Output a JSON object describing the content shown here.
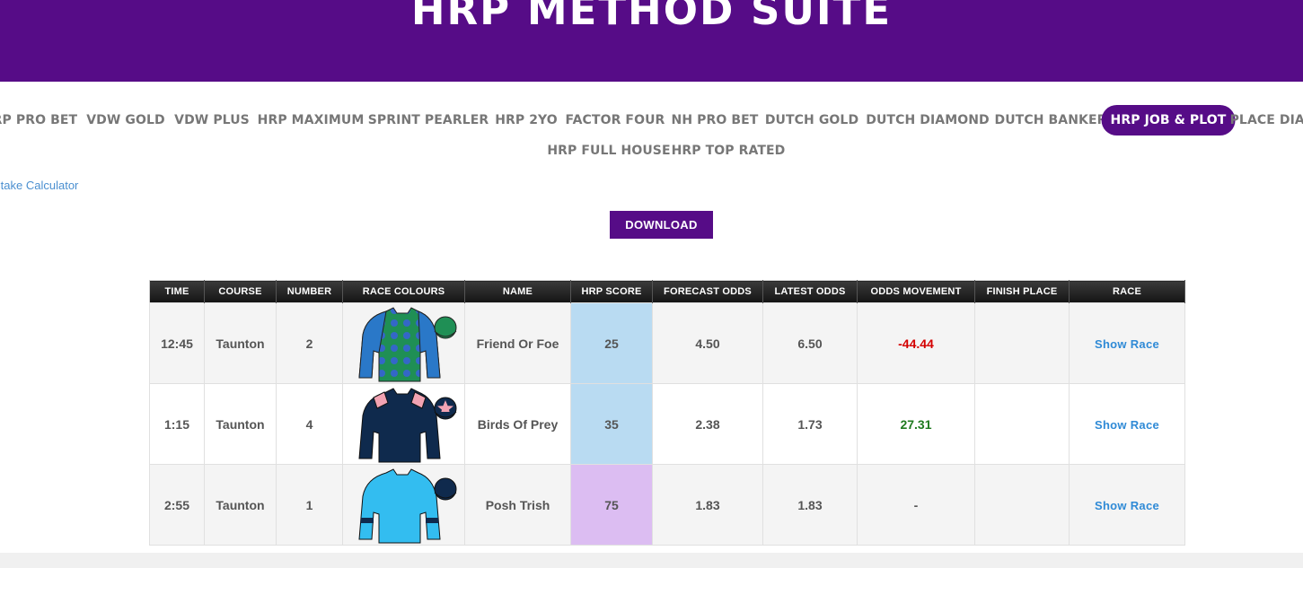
{
  "header": {
    "title": "HRP METHOD SUITE"
  },
  "nav": {
    "row1": [
      "HRP PRO BET",
      "VDW GOLD",
      "VDW PLUS",
      "HRP MAXIMUM",
      "SPRINT PEARLER",
      "HRP 2YO",
      "FACTOR FOUR",
      "NH PRO BET",
      "DUTCH GOLD",
      "DUTCH DIAMOND",
      "DUTCH BANKER",
      "HRP JOB & PLOT",
      "PLACE DIAMOND"
    ],
    "row2": [
      "HRP FULL HOUSE",
      "HRP TOP RATED"
    ],
    "active": "HRP JOB & PLOT"
  },
  "calculator_link": "Stake Calculator",
  "download_label": "DOWNLOAD",
  "table": {
    "columns": [
      "TIME",
      "COURSE",
      "NUMBER",
      "RACE COLOURS",
      "NAME",
      "HRP SCORE",
      "FORECAST ODDS",
      "LATEST ODDS",
      "ODDS MOVEMENT",
      "FINISH PLACE",
      "RACE"
    ],
    "rows": [
      {
        "time": "12:45",
        "course": "Taunton",
        "number": "2",
        "silks": "green-jacket-blue-spots-silks-icon",
        "name": "Friend Or Foe",
        "hrp_score": "25",
        "forecast_odds": "4.50",
        "latest_odds": "6.50",
        "odds_movement": "-44.44",
        "finish_place": "",
        "race": "Show Race"
      },
      {
        "time": "1:15",
        "course": "Taunton",
        "number": "4",
        "silks": "navy-jacket-pink-epaulets-silks-icon",
        "name": "Birds Of Prey",
        "hrp_score": "35",
        "forecast_odds": "2.38",
        "latest_odds": "1.73",
        "odds_movement": "27.31",
        "finish_place": "",
        "race": "Show Race"
      },
      {
        "time": "2:55",
        "course": "Taunton",
        "number": "1",
        "silks": "light-blue-jacket-navy-armbands-silks-icon",
        "name": "Posh Trish",
        "hrp_score": "75",
        "forecast_odds": "1.83",
        "latest_odds": "1.83",
        "odds_movement": "-",
        "finish_place": "",
        "race": "Show Race"
      }
    ]
  },
  "colors": {
    "brand_purple": "#560c87",
    "score_blue": "#b9dbf2",
    "score_purple": "#dcbdf2",
    "negative": "#d40000",
    "positive": "#1f7a1f",
    "link_blue": "#2f8ad6"
  }
}
